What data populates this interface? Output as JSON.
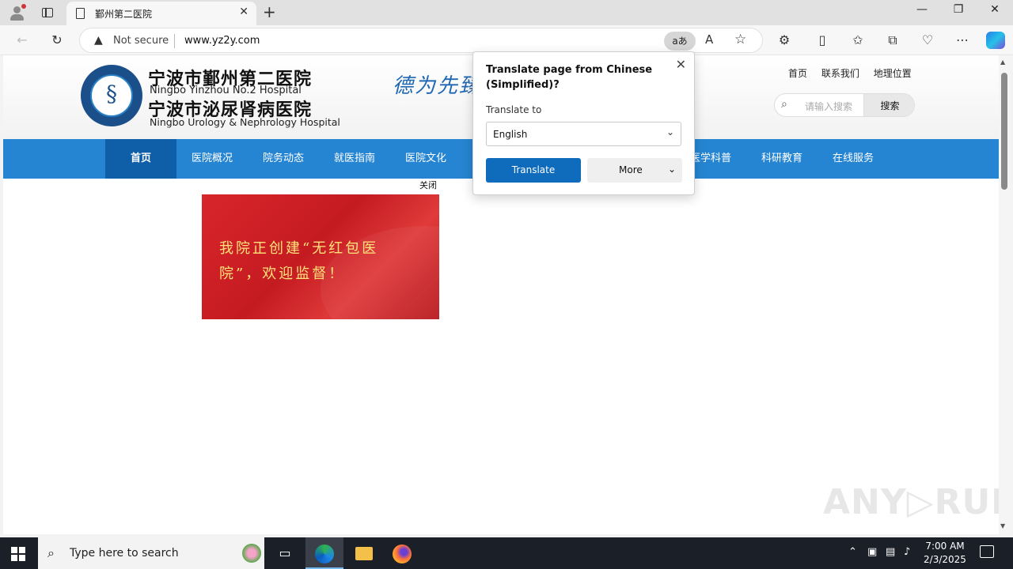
{
  "browser": {
    "tab_title": "鄞州第二医院",
    "tab_close": "✕",
    "new_tab": "+",
    "window_controls": {
      "minimize": "—",
      "restore": "❐",
      "close": "✕"
    },
    "security_label": "Not secure",
    "url": "www.yz2y.com",
    "translate_icon_text": "aあ",
    "read_aloud_icon_text": "A"
  },
  "site": {
    "name_cn_1": "宁波市鄞州第二医院",
    "name_en_1": "Ningbo Yinzhou No.2 Hospital",
    "name_cn_2": "宁波市泌尿肾病医院",
    "name_en_2": "Ningbo Urology & Nephrology Hospital",
    "slogan": "德为先臻",
    "top_links": [
      "首页",
      "联系我们",
      "地理位置"
    ],
    "search_placeholder": "请输入搜索",
    "search_button": "搜索",
    "nav": [
      "首页",
      "医院概况",
      "院务动态",
      "就医指南",
      "医院文化",
      "医学科普",
      "科研教育",
      "在线服务"
    ],
    "close_label": "关闭",
    "banner_line1": "我院正创建“无红包医",
    "banner_line2": "院”，欢迎监督！"
  },
  "translate_popup": {
    "title": "Translate page from Chinese (Simplified)?",
    "translate_to_label": "Translate to",
    "language_value": "English",
    "translate_button": "Translate",
    "more_button": "More"
  },
  "watermark": "ANY▷RUN",
  "taskbar": {
    "search_placeholder": "Type here to search",
    "time": "7:00 AM",
    "date": "2/3/2025"
  },
  "colors": {
    "nav_blue": "#2585d2",
    "nav_active": "#0f5ea8",
    "translate_button": "#0f6cbd",
    "banner_red": "#c41b21",
    "banner_text": "#ffe27a"
  }
}
